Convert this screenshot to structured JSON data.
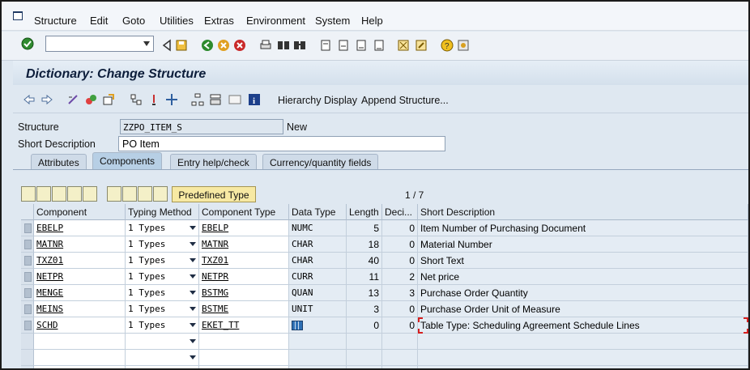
{
  "menu": [
    "Structure",
    "Edit",
    "Goto",
    "Utilities",
    "Extras",
    "Environment",
    "System",
    "Help"
  ],
  "title": "Dictionary: Change Structure",
  "toolbar2": {
    "hierarchy_display": "Hierarchy Display",
    "append_structure": "Append Structure..."
  },
  "header": {
    "structure_label": "Structure",
    "structure_value": "ZZPO_ITEM_S",
    "status": "New",
    "short_desc_label": "Short Description",
    "short_desc_value": "PO Item"
  },
  "tabs": [
    "Attributes",
    "Components",
    "Entry help/check",
    "Currency/quantity fields"
  ],
  "active_tab": "Components",
  "predefined_type_label": "Predefined Type",
  "row_counter": "1 / 7",
  "columns": [
    "Component",
    "Typing Method",
    "Component Type",
    "Data Type",
    "Length",
    "Deci...",
    "Short Description"
  ],
  "rows": [
    [
      "EBELP",
      "1 Types",
      "EBELP",
      "NUMC",
      "5",
      "0",
      "Item Number of Purchasing Document"
    ],
    [
      "MATNR",
      "1 Types",
      "MATNR",
      "CHAR",
      "18",
      "0",
      "Material Number"
    ],
    [
      "TXZ01",
      "1 Types",
      "TXZ01",
      "CHAR",
      "40",
      "0",
      "Short Text"
    ],
    [
      "NETPR",
      "1 Types",
      "NETPR",
      "CURR",
      "11",
      "2",
      "Net price"
    ],
    [
      "MENGE",
      "1 Types",
      "BSTMG",
      "QUAN",
      "13",
      "3",
      "Purchase Order Quantity"
    ],
    [
      "MEINS",
      "1 Types",
      "BSTME",
      "UNIT",
      "3",
      "0",
      "Purchase Order Unit of Measure"
    ],
    [
      "SCHD",
      "1 Types",
      "EKET_TT",
      "",
      "0",
      "0",
      "Table Type: Scheduling Agreement Schedule Lines"
    ]
  ],
  "colors": {
    "accent": "#0c1d3a",
    "panel": "#dfe8f1",
    "selected_tab": "#b7cfe5",
    "highlight": "#d51f1f"
  }
}
